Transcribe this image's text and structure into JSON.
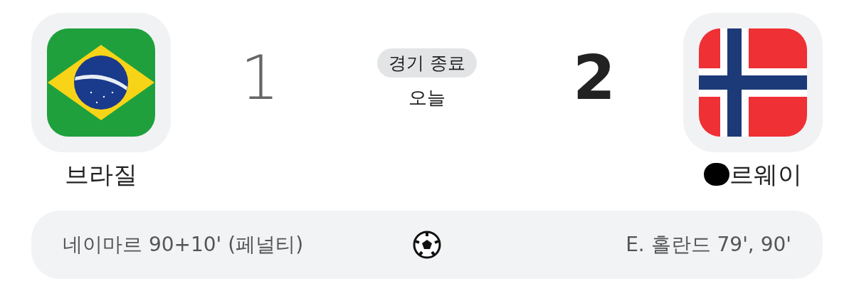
{
  "match": {
    "status": "경기 종료",
    "date": "오늘"
  },
  "teams": [
    {
      "name": "브라질",
      "redacted": false,
      "score": "1",
      "winner": false
    },
    {
      "name": "르웨이",
      "redacted": true,
      "score": "2",
      "winner": true
    }
  ],
  "goals": {
    "home": "네이마르 90+10' (페널티)",
    "away": "E. 홀란드 79', 90'"
  }
}
